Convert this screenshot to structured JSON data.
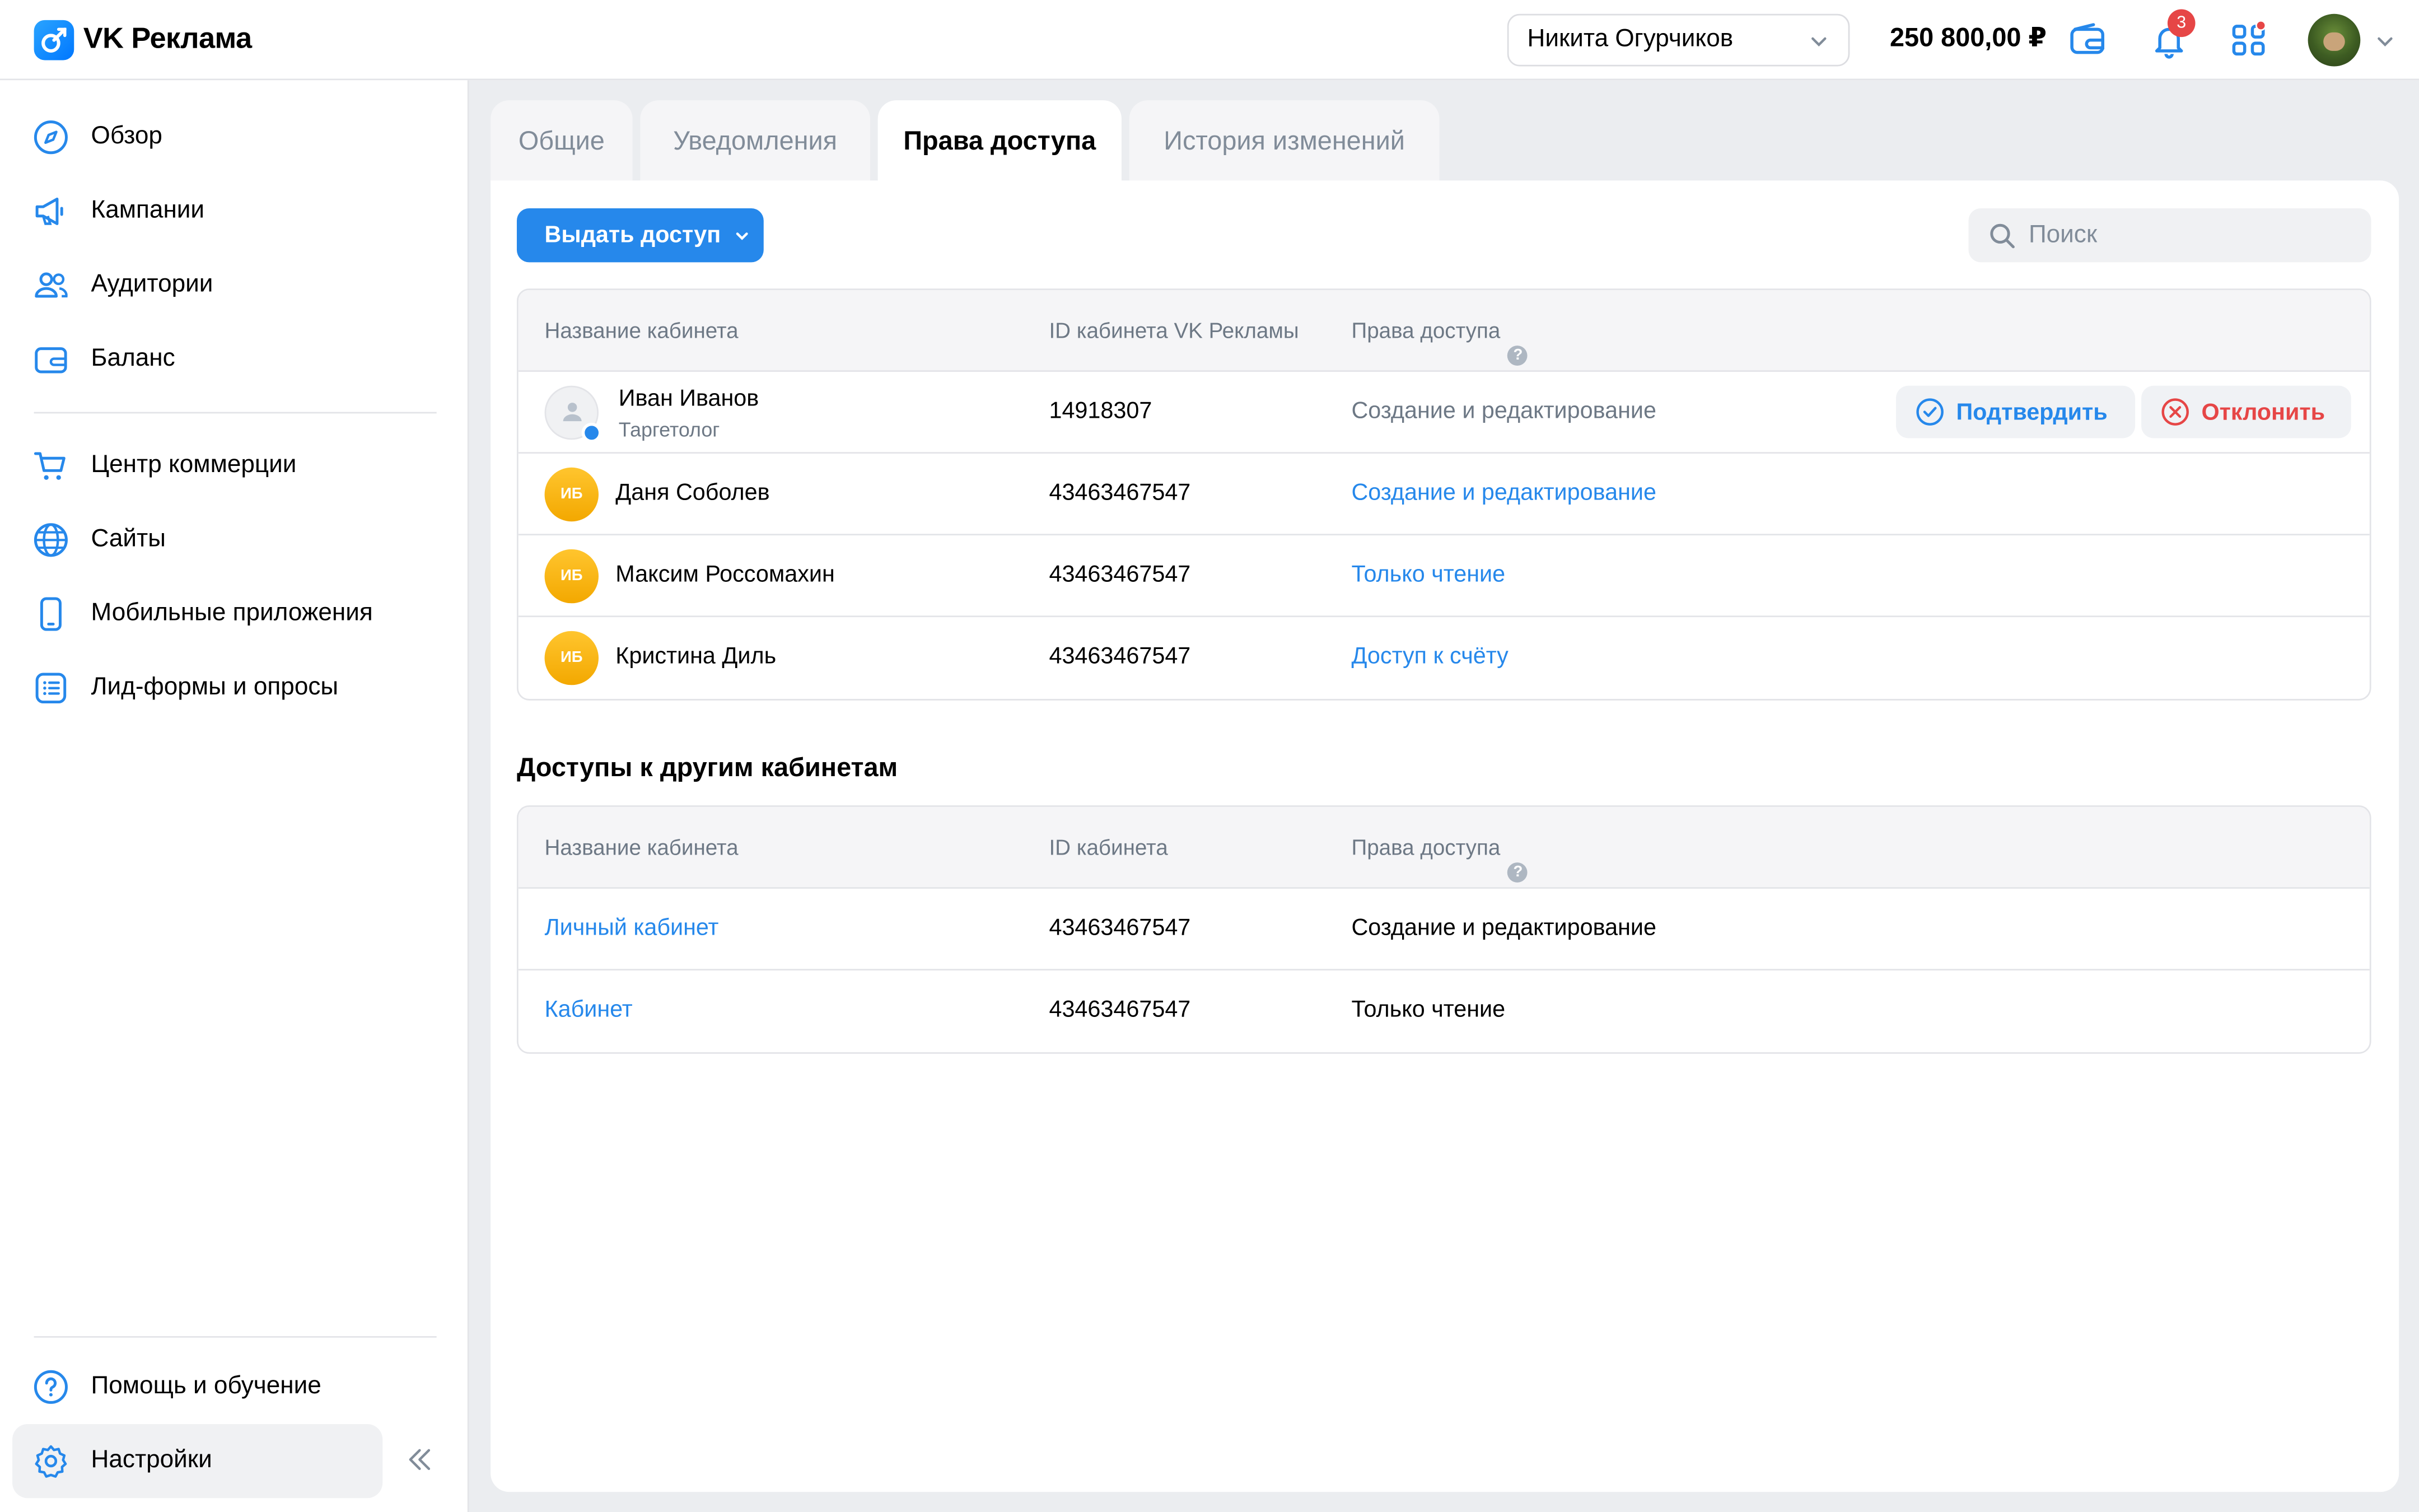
{
  "app": {
    "name": "VK Реклама"
  },
  "header": {
    "account": "Никита Огурчиков",
    "balance": "250 800,00 ₽",
    "notifications_count": "3"
  },
  "sidebar": {
    "items": [
      {
        "label": "Обзор",
        "icon": "compass-icon"
      },
      {
        "label": "Кампании",
        "icon": "megaphone-icon"
      },
      {
        "label": "Аудитории",
        "icon": "users-icon"
      },
      {
        "label": "Баланс",
        "icon": "wallet-icon"
      },
      {
        "label": "Центр коммерции",
        "icon": "cart-icon"
      },
      {
        "label": "Сайты",
        "icon": "globe-icon"
      },
      {
        "label": "Мобильные приложения",
        "icon": "phone-icon"
      },
      {
        "label": "Лид-формы и опросы",
        "icon": "list-icon"
      }
    ],
    "bottom": [
      {
        "label": "Помощь и обучение",
        "icon": "help-icon"
      },
      {
        "label": "Настройки",
        "icon": "gear-icon"
      }
    ]
  },
  "tabs": [
    "Общие",
    "Уведомления",
    "Права доступа",
    "История изменений"
  ],
  "active_tab": "Права доступа",
  "toolbar": {
    "grant_label": "Выдать доступ",
    "search_placeholder": "Поиск"
  },
  "access_table": {
    "columns": [
      "Название кабинета",
      "ID кабинета VK Рекламы",
      "Права доступа"
    ],
    "pending": {
      "name": "Иван Иванов",
      "role": "Таргетолог",
      "id": "14918307",
      "rights": "Создание и редактирование",
      "confirm_label": "Подтвердить",
      "reject_label": "Отклонить"
    },
    "rows": [
      {
        "initials": "ИБ",
        "name": "Даня Соболев",
        "id": "43463467547",
        "rights": "Создание и редактирование"
      },
      {
        "initials": "ИБ",
        "name": "Максим Россомахин",
        "id": "43463467547",
        "rights": "Только чтение"
      },
      {
        "initials": "ИБ",
        "name": "Кристина Диль",
        "id": "43463467547",
        "rights": "Доступ к счёту"
      }
    ]
  },
  "other_accounts": {
    "title": "Доступы к другим кабинетам",
    "columns": [
      "Название кабинета",
      "ID кабинета",
      "Права доступа"
    ],
    "rows": [
      {
        "name": "Личный кабинет",
        "id": "43463467547",
        "rights": "Создание и редактирование"
      },
      {
        "name": "Кабинет",
        "id": "43463467547",
        "rights": "Только чтение"
      }
    ]
  },
  "colors": {
    "accent": "#2688eb",
    "danger": "#e64646",
    "avatar": "#f5b400"
  }
}
